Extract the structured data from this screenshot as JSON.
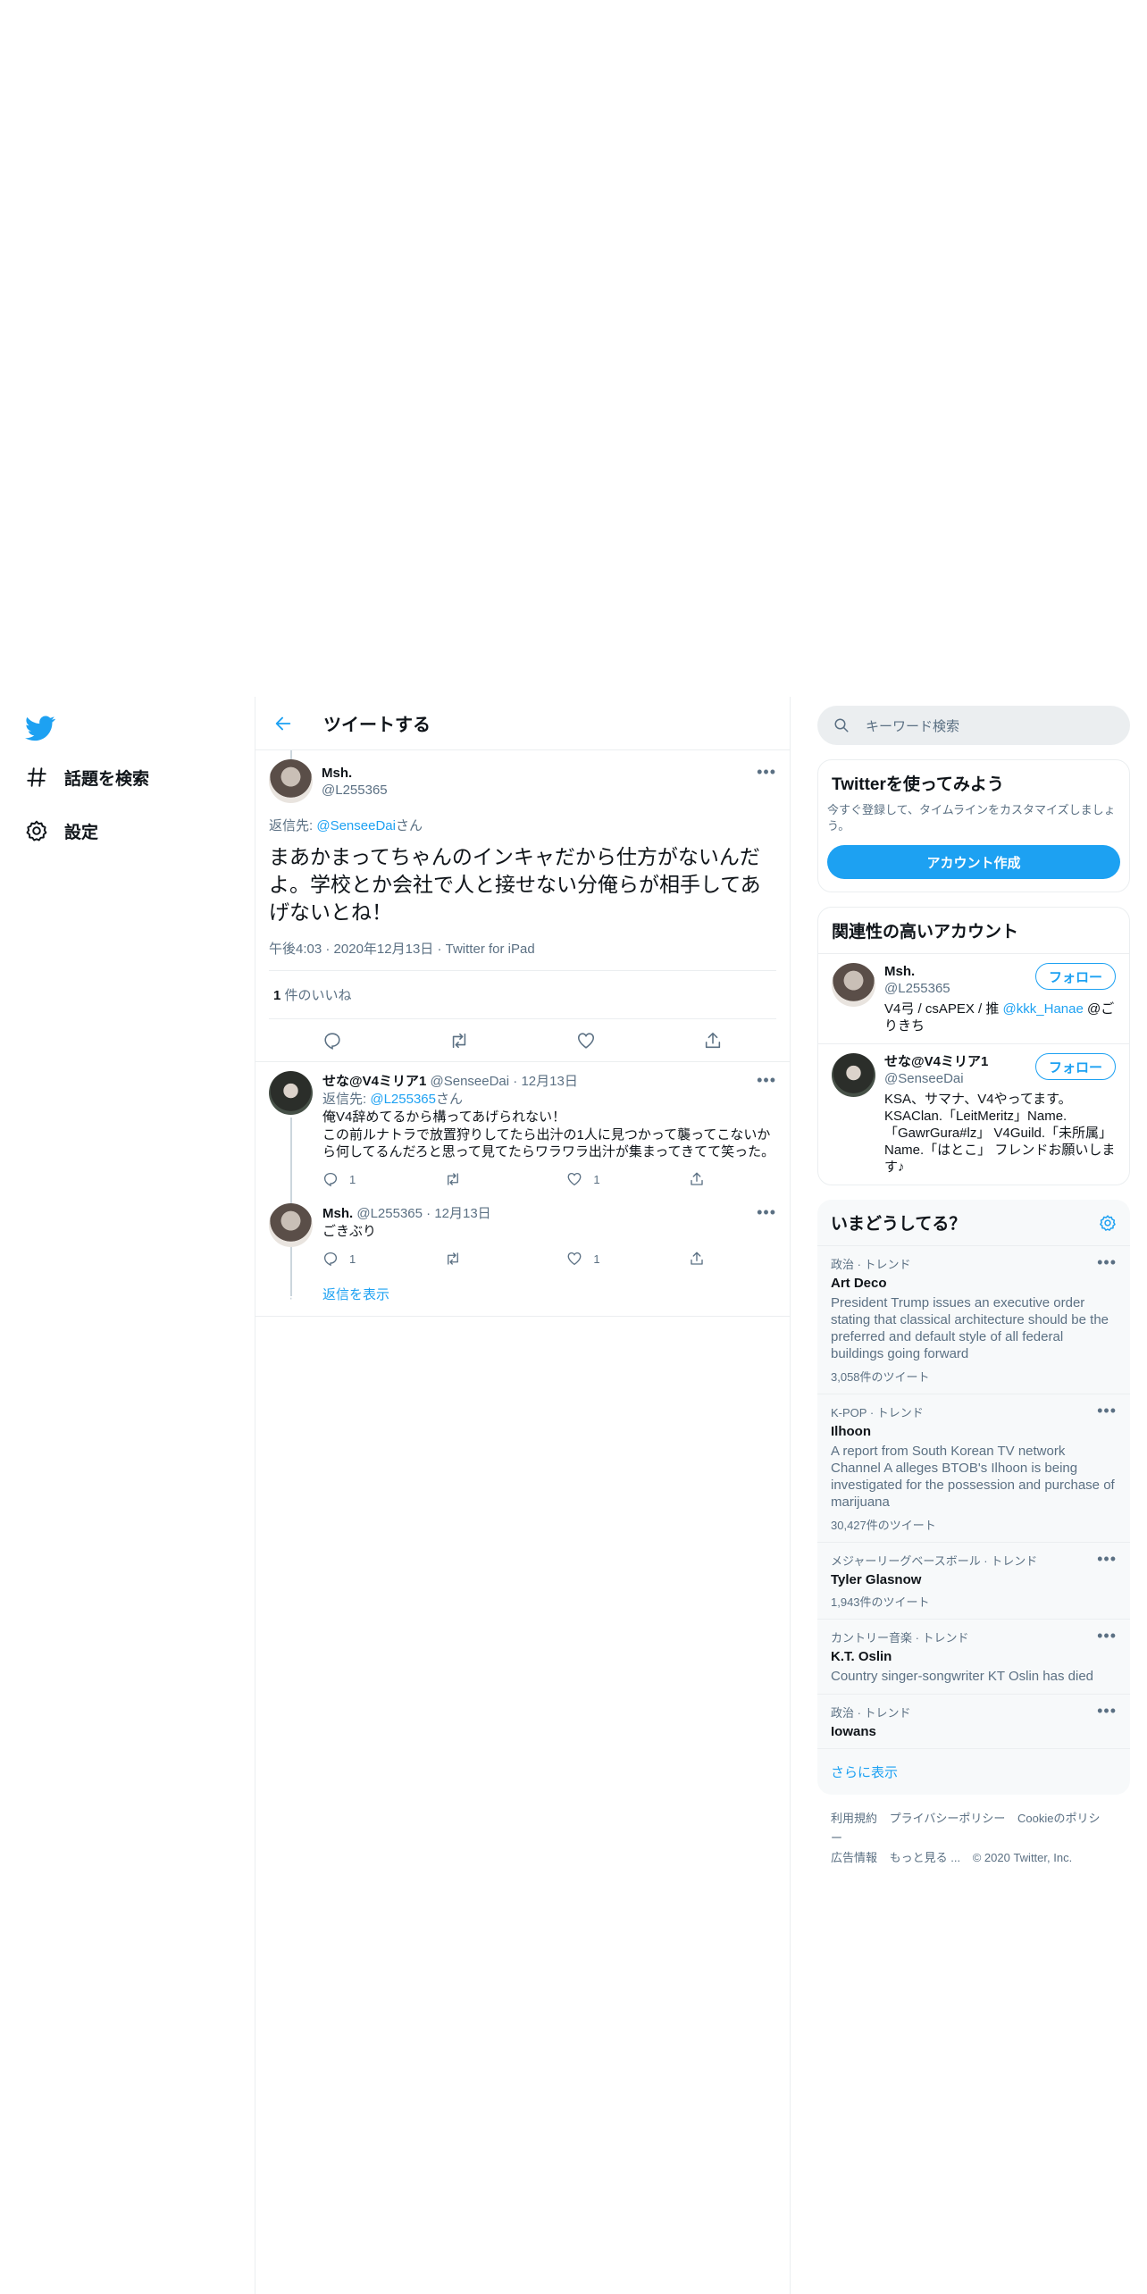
{
  "nav": {
    "explore": "話題を検索",
    "settings": "設定"
  },
  "header": {
    "title": "ツイートする"
  },
  "main_tweet": {
    "name": "Msh.",
    "handle": "@L255365",
    "reply_prefix": "返信先: ",
    "reply_handle": "@SenseeDai",
    "reply_suffix": "さん",
    "text": "まあかまってちゃんのインキャだから仕方がないんだよ。学校とか会社で人と接せない分俺らが相手してあげないとね！",
    "time": "午後4:03",
    "date": "2020年12月13日",
    "source": "Twitter for iPad",
    "likes_count": "1",
    "likes_label": " 件のいいね"
  },
  "replies": [
    {
      "name": "せな@V4ミリア1",
      "handle": "@SenseeDai",
      "date": "12月13日",
      "reply_prefix": "返信先: ",
      "reply_handle": "@L255365",
      "reply_suffix": "さん",
      "line1": "俺V4辞めてるから構ってあげられない！",
      "line2": "この前ルナトラで放置狩りしてたら出汁の1人に見つかって襲ってこないから何してるんだろと思って見てたらワラワラ出汁が集まってきてて笑った。",
      "reply_count": "1",
      "retweet_count": "",
      "like_count": "1"
    },
    {
      "name": "Msh.",
      "handle": "@L255365",
      "date": "12月13日",
      "text": "ごきぶり",
      "reply_count": "1",
      "retweet_count": "",
      "like_count": "1"
    }
  ],
  "show_replies": "返信を表示",
  "search": {
    "placeholder": "キーワード検索"
  },
  "try_card": {
    "title": "Twitterを使ってみよう",
    "subtitle": "今すぐ登録して、タイムラインをカスタマイズしましょう。",
    "button": "アカウント作成"
  },
  "relevant": {
    "title": "関連性の高いアカウント",
    "follow_label": "フォロー",
    "accounts": [
      {
        "name": "Msh.",
        "handle": "@L255365",
        "bio_a": "V4弓 / csAPEX / 推 ",
        "bio_link": "@kkk_Hanae",
        "bio_b": " @ごりきち"
      },
      {
        "name": "せな@V4ミリア1",
        "handle": "@SenseeDai",
        "bio": "KSA、サマナ、V4やってます。KSAClan.「LeitMeritz」Name.「GawrGura#lz」 V4Guild.「未所属」Name.「はとこ」 フレンドお願いします♪"
      }
    ]
  },
  "trends": {
    "title": "いまどうしてる？",
    "items": [
      {
        "context": "政治 · トレンド",
        "title": "Art Deco",
        "desc": "President Trump issues an executive order stating that classical architecture should be the preferred and default style of all federal buildings going forward",
        "count": "3,058件のツイート"
      },
      {
        "context": "K-POP · トレンド",
        "title": "Ilhoon",
        "desc": "A report from South Korean TV network Channel A alleges BTOB's Ilhoon is being investigated for the possession and purchase of marijuana",
        "count": "30,427件のツイート"
      },
      {
        "context": "メジャーリーグベースボール · トレンド",
        "title": "Tyler Glasnow",
        "desc": "",
        "count": "1,943件のツイート"
      },
      {
        "context": "カントリー音楽 · トレンド",
        "title": "K.T. Oslin",
        "desc": "Country singer-songwriter KT Oslin has died",
        "count": ""
      },
      {
        "context": "政治 · トレンド",
        "title": "Iowans",
        "desc": "",
        "count": ""
      }
    ],
    "show_more": "さらに表示"
  },
  "footer": {
    "terms": "利用規約",
    "privacy": "プライバシーポリシー",
    "cookie": "Cookieのポリシー",
    "ads": "広告情報",
    "more": "もっと見る ...",
    "copyright": "© 2020 Twitter, Inc."
  },
  "colors": {
    "accent": "#1da1f2",
    "text": "#0f1419",
    "secondary": "#5b7083",
    "border": "#ebeef0"
  }
}
